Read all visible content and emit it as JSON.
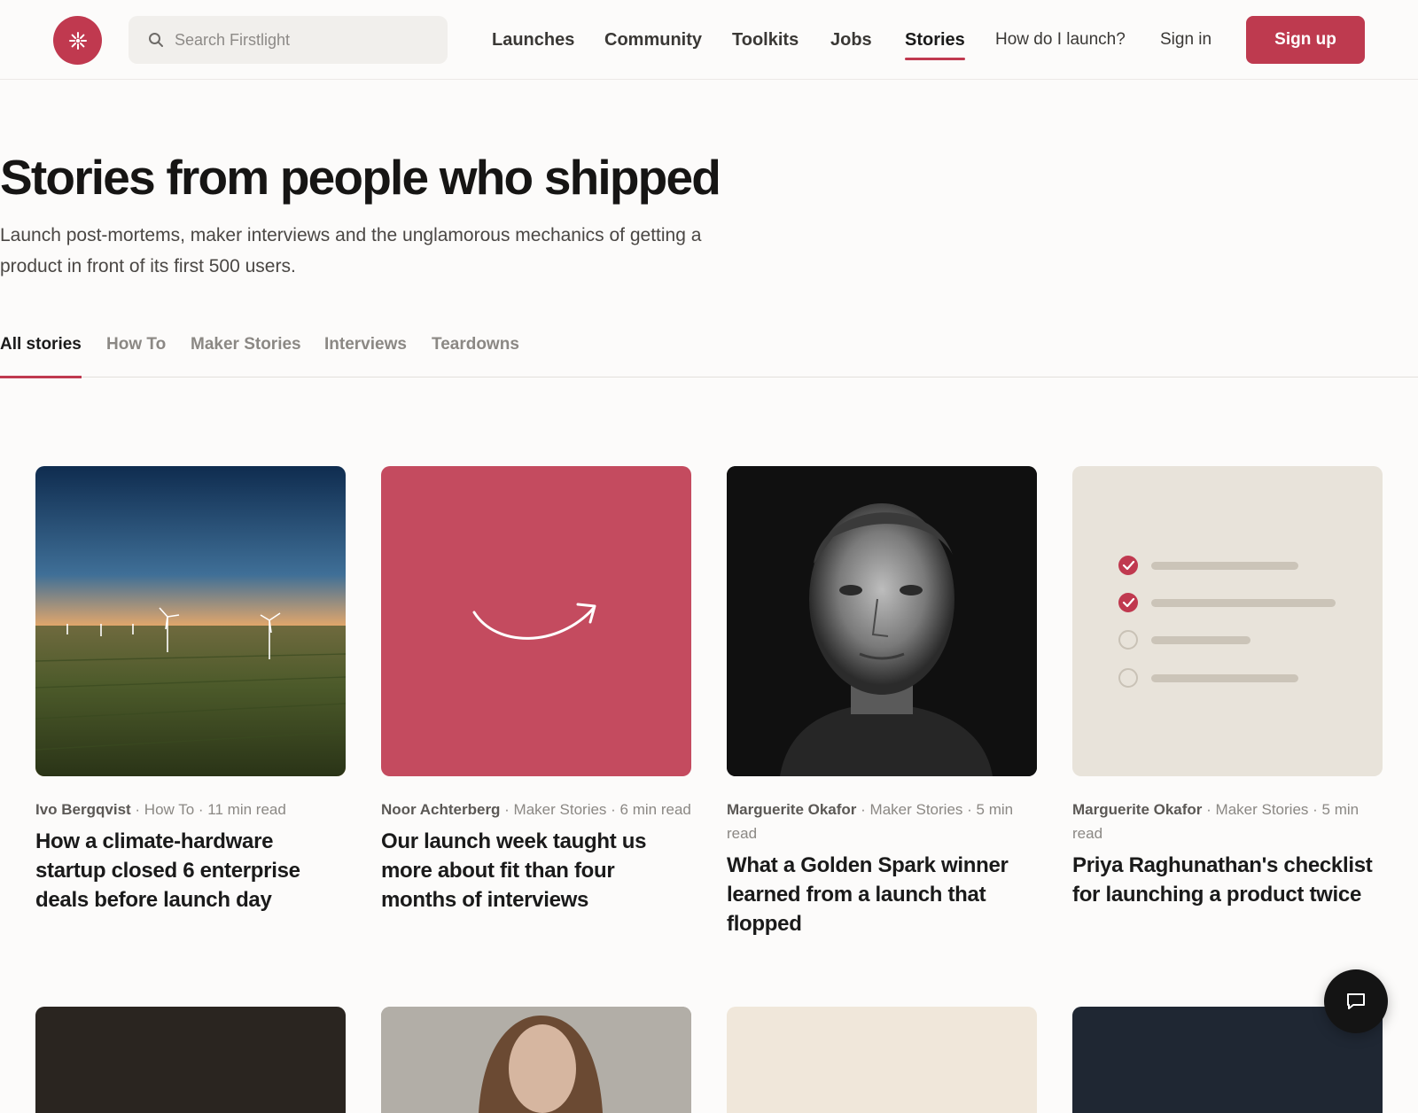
{
  "header": {
    "logo_icon": "spark-icon",
    "search": {
      "placeholder": "Search Firstlight"
    },
    "nav": {
      "launches": "Launches",
      "community": "Community",
      "toolkits": "Toolkits",
      "jobs": "Jobs",
      "stories": "Stories",
      "how": "How do I launch?",
      "signin": "Sign in"
    },
    "signup": "Sign up"
  },
  "hero": {
    "title": "Stories from people who shipped",
    "subtitle": "Launch post-mortems, maker interviews and the unglamorous mechanics of getting a product in front of its first 500 users."
  },
  "tabs": [
    "All stories",
    "How To",
    "Maker Stories",
    "Interviews",
    "Teardowns"
  ],
  "active_tab": "All stories",
  "cards": [
    {
      "author": "Ivo Bergqvist",
      "meta": " · How To · 11 min read",
      "title": "How a climate-hardware startup closed 6 enterprise deals before launch day",
      "image": "wind-farm-sunset-photo"
    },
    {
      "author": "Noor Achterberg",
      "meta": " · Maker Stories · 6 min read",
      "title": "Our launch week taught us more about fit than four months of interviews",
      "image": "smile-arrow-illustration"
    },
    {
      "author": "Marguerite Okafor",
      "meta": " · Maker Stories · 5 min read",
      "title": "What a Golden Spark winner learned from a launch that flopped",
      "image": "portrait-photo"
    },
    {
      "author": "Marguerite Okafor",
      "meta": " · Maker Stories · 5 min read",
      "title": "Priya Raghunathan's checklist for launching a product twice",
      "image": "checklist-illustration"
    }
  ],
  "colors": {
    "accent": "#c0394f",
    "background": "#fcfbfa"
  },
  "chat_icon": "chat-bubble-icon"
}
